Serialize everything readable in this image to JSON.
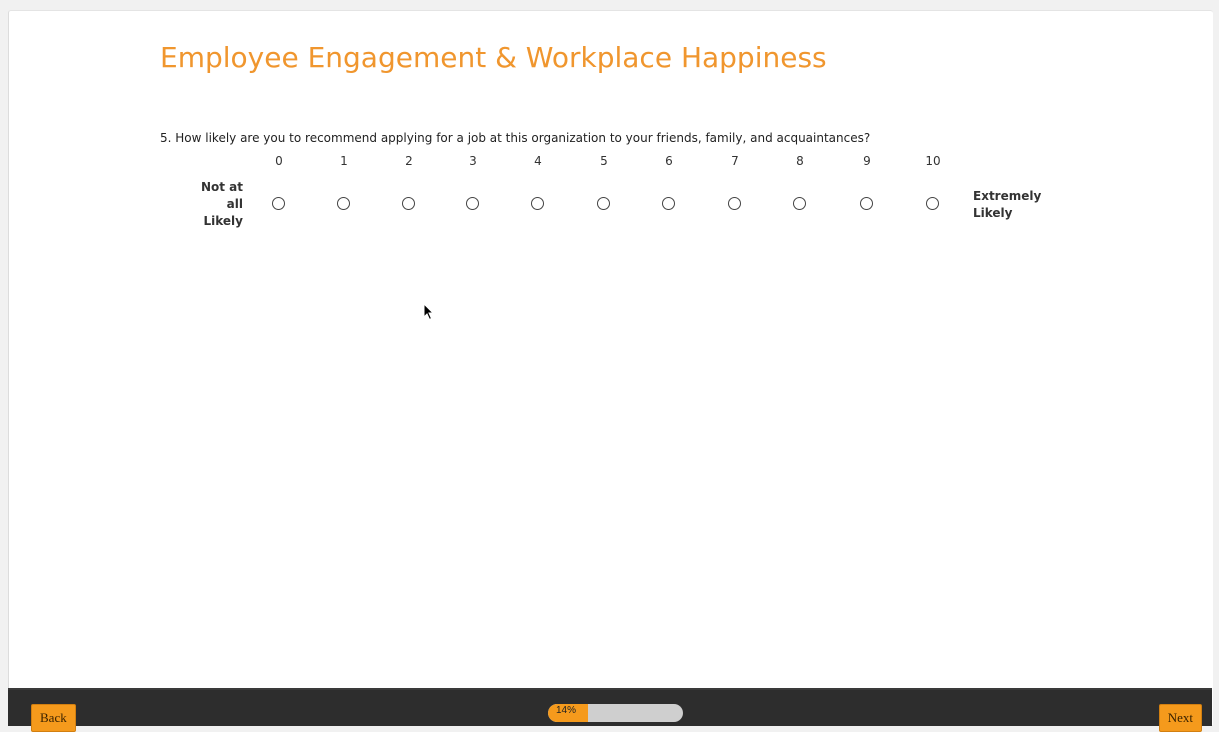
{
  "survey": {
    "title": "Employee Engagement & Workplace Happiness"
  },
  "question": {
    "text": "5. How likely are you to recommend applying for a job at this organization to your friends, family, and acquaintances?",
    "scale": [
      "0",
      "1",
      "2",
      "3",
      "4",
      "5",
      "6",
      "7",
      "8",
      "9",
      "10"
    ],
    "low_label": [
      "Not at",
      "all",
      "Likely"
    ],
    "high_label": [
      "Extremely",
      "Likely"
    ],
    "selected": null
  },
  "footer": {
    "back_label": "Back",
    "next_label": "Next",
    "progress": {
      "percent": 14,
      "label": "14%"
    }
  },
  "colors": {
    "accent": "#f0962e",
    "button": "#f59a1c",
    "footer_bg": "#2d2d2d",
    "progress_track": "#cfcfcf"
  },
  "icons": {
    "cursor": "mouse-pointer-icon"
  }
}
